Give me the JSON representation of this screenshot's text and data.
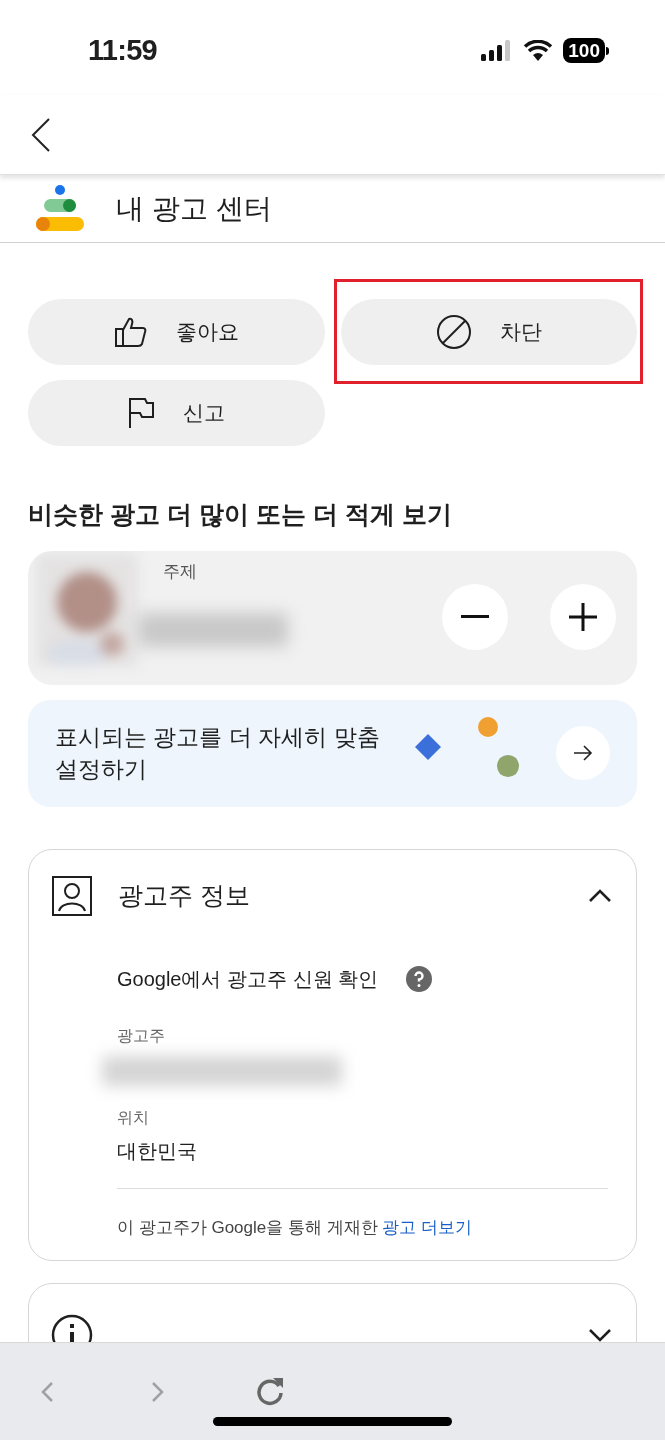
{
  "status_bar": {
    "time": "11:59",
    "battery": "100"
  },
  "app_title": "내 광고 센터",
  "actions": [
    {
      "label": "좋아요",
      "highlighted": false
    },
    {
      "label": "차단",
      "highlighted": true
    },
    {
      "label": "신고",
      "highlighted": false
    }
  ],
  "similar_ads": {
    "heading": "비슷한 광고 더 많이 또는 더 적게 보기",
    "topic_label": "주제"
  },
  "customize_card": {
    "text": "표시되는 광고를 더 자세히 맞춤 설정하기"
  },
  "advertiser_section": {
    "title": "광고주 정보",
    "expanded": true,
    "verification": "Google에서 광고주 신원 확인",
    "advertiser_label": "광고주",
    "location_label": "위치",
    "location": "대한민국",
    "more_text": "이 광고주가 Google을 통해 게재한 ",
    "more_link": "광고 더보기"
  },
  "why_section": {
    "expanded": false
  }
}
